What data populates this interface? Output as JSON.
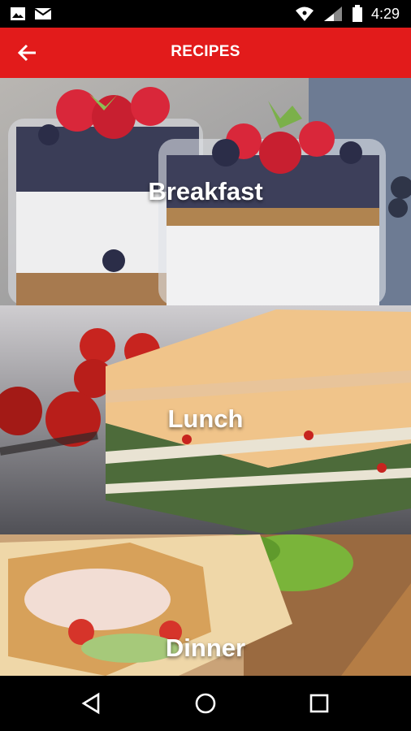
{
  "status_bar": {
    "time": "4:29",
    "icons": [
      "image-icon",
      "mail-icon",
      "wifi-icon",
      "signal-icon",
      "battery-icon"
    ]
  },
  "app_bar": {
    "title": "RECIPES",
    "back_icon": "arrow-left-icon",
    "color": "#e21b1b"
  },
  "categories": [
    {
      "label": "Breakfast",
      "image": "yogurt parfait with berries"
    },
    {
      "label": "Lunch",
      "image": "spinach lasagna with tomatoes"
    },
    {
      "label": "Dinner",
      "image": "chicken wrap with salad"
    }
  ],
  "nav_bar": {
    "icons": [
      "back-triangle-icon",
      "home-circle-icon",
      "recents-square-icon"
    ]
  }
}
